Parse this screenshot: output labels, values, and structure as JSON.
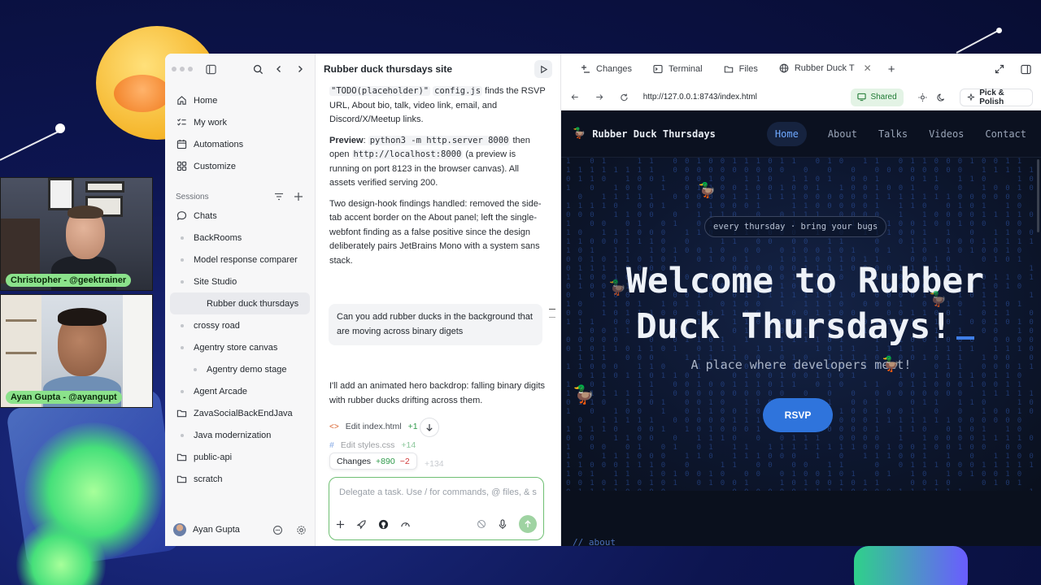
{
  "colors": {
    "accent_green": "#6fbf73",
    "site_accent": "#2f74dc",
    "site_bg": "#0a101d",
    "added": "#2e9a4a",
    "removed": "#d23b3b"
  },
  "webcams": [
    {
      "label": "Christopher - @geektrainer"
    },
    {
      "label": "Ayan Gupta - @ayangupt"
    }
  ],
  "sidebar": {
    "nav": [
      {
        "label": "Home",
        "icon": "home-icon"
      },
      {
        "label": "My work",
        "icon": "checklist-icon"
      },
      {
        "label": "Automations",
        "icon": "calendar-icon"
      },
      {
        "label": "Customize",
        "icon": "grid-icon"
      }
    ],
    "sessions_title": "Sessions",
    "sessions": [
      {
        "label": "Chats",
        "kind": "chat"
      },
      {
        "label": "BackRooms",
        "kind": "bullet"
      },
      {
        "label": "Model response comparer",
        "kind": "bullet"
      },
      {
        "label": "Site Studio",
        "kind": "bullet"
      },
      {
        "label": "Rubber duck thursdays",
        "kind": "sub-active"
      },
      {
        "label": "crossy road",
        "kind": "bullet"
      },
      {
        "label": "Agentry store canvas",
        "kind": "bullet"
      },
      {
        "label": "Agentry demo stage",
        "kind": "sub"
      },
      {
        "label": "Agent Arcade",
        "kind": "bullet"
      },
      {
        "label": "ZavaSocialBackEndJava",
        "kind": "folder"
      },
      {
        "label": "Java modernization",
        "kind": "bullet"
      },
      {
        "label": "public-api",
        "kind": "folder"
      },
      {
        "label": "scratch",
        "kind": "folder"
      }
    ],
    "user_name": "Ayan Gupta"
  },
  "chat": {
    "title": "Rubber duck thursdays site",
    "para1_code1": "\"TODO(placeholder)\"",
    "para1_code2": "config.js",
    "para1_text": "finds the RSVP URL, About bio, talk, video link, email, and Discord/X/Meetup links.",
    "para2_label": "Preview",
    "para2_code1": "python3 -m http.server 8000",
    "para2_mid": "then open",
    "para2_code2": "http://localhost:8000",
    "para2_text": "(a preview is running on port 8123 in the browser canvas). All assets verified serving 200.",
    "para3": "Two design-hook findings handled: removed the side-tab accent border on the About panel; left the single-webfont finding as a false positive since the design deliberately pairs JetBrains Mono with a system sans stack.",
    "user_message": "Can you add rubber ducks in the background that are moving across binary digets",
    "reply": "I'll add an animated hero backdrop: falling binary digits with rubber ducks drifting across them.",
    "edits": [
      {
        "label": "Edit index.html",
        "count": "+1"
      },
      {
        "label": "Edit styles.css",
        "count": "+14"
      }
    ],
    "ghost_count": "+134",
    "changes_label": "Changes",
    "changes_added": "+890",
    "changes_removed": "−2",
    "composer_placeholder": "Delegate a task. Use / for commands, @ files, & s"
  },
  "browser": {
    "tabs": [
      {
        "label": "Changes",
        "icon": "plus-minus-icon"
      },
      {
        "label": "Terminal",
        "icon": "terminal-icon"
      },
      {
        "label": "Files",
        "icon": "folder-icon"
      },
      {
        "label": "Rubber Duck T",
        "icon": "globe-icon"
      }
    ],
    "url": "http://127.0.0.1:8743/index.html",
    "shared_label": "Shared",
    "pick_polish_label": "Pick & Polish"
  },
  "site": {
    "brand": "Rubber Duck Thursdays",
    "nav": [
      "Home",
      "About",
      "Talks",
      "Videos",
      "Contact"
    ],
    "tagline": "every thursday · bring your bugs",
    "title_line1": "Welcome to Rubber",
    "title_line2": "Duck Thursdays!",
    "subtitle": "A place where developers meet!",
    "cta": "RSVP",
    "about_hint": "// about"
  }
}
